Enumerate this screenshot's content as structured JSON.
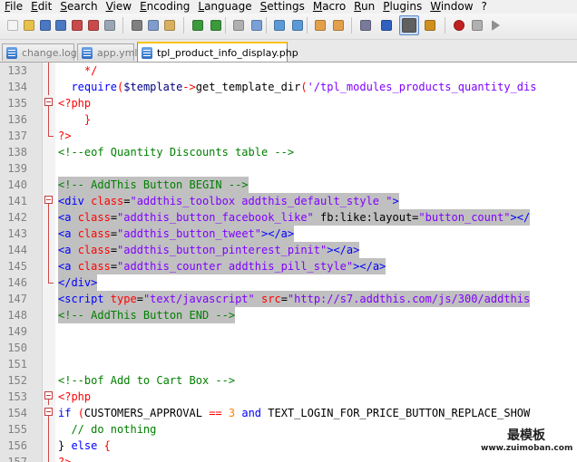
{
  "menu": [
    "File",
    "Edit",
    "Search",
    "View",
    "Encoding",
    "Language",
    "Settings",
    "Macro",
    "Run",
    "Plugins",
    "Window",
    "?"
  ],
  "toolbar": {
    "icons": [
      "new-file-icon",
      "open-file-icon",
      "save-icon",
      "save-all-icon",
      "close-icon",
      "close-all-icon",
      "print-icon",
      "cut-icon",
      "copy-icon",
      "paste-icon",
      "undo-icon",
      "redo-icon",
      "find-icon",
      "replace-icon",
      "zoom-in-icon",
      "zoom-out-icon",
      "sync-vertical-icon",
      "sync-horizontal-icon",
      "word-wrap-icon",
      "show-all-chars-icon",
      "indent-guide-icon",
      "user-lang-icon",
      "record-macro-icon",
      "stop-macro-icon",
      "play-macro-icon"
    ],
    "colors": {
      "bg": "#f0f0f0",
      "selected": "#c9dcf5"
    }
  },
  "tabs": [
    {
      "label": "change.log",
      "active": false
    },
    {
      "label": "app.yml",
      "active": false
    },
    {
      "label": "tpl_product_info_display.php",
      "active": true
    }
  ],
  "editor": {
    "lines": [
      {
        "n": "133",
        "fold": "line",
        "hl": false,
        "tokens": [
          [
            "plain",
            "    "
          ],
          [
            "op",
            "*/"
          ]
        ]
      },
      {
        "n": "134",
        "fold": "line",
        "hl": false,
        "tokens": [
          [
            "plain",
            "  "
          ],
          [
            "kw",
            "require"
          ],
          [
            "op",
            "("
          ],
          [
            "var",
            "$template"
          ],
          [
            "op",
            "->"
          ],
          [
            "plain",
            "get_template_dir"
          ],
          [
            "op",
            "("
          ],
          [
            "str",
            "'/tpl_modules_products_quantity_dis"
          ]
        ]
      },
      {
        "n": "135",
        "fold": "box",
        "hl": false,
        "tokens": [
          [
            "php",
            "<?php"
          ]
        ]
      },
      {
        "n": "136",
        "fold": "line",
        "hl": false,
        "tokens": [
          [
            "plain",
            "    "
          ],
          [
            "op",
            "}"
          ]
        ]
      },
      {
        "n": "137",
        "fold": "end",
        "hl": false,
        "tokens": [
          [
            "php",
            "?>"
          ]
        ]
      },
      {
        "n": "138",
        "fold": "none",
        "hl": false,
        "tokens": [
          [
            "cmt",
            "<!--eof Quantity Discounts table -->"
          ]
        ]
      },
      {
        "n": "139",
        "fold": "none",
        "hl": false,
        "tokens": []
      },
      {
        "n": "140",
        "fold": "none",
        "hl": true,
        "tokens": [
          [
            "cmt",
            "<!-- AddThis Button BEGIN -->"
          ]
        ]
      },
      {
        "n": "141",
        "fold": "box",
        "hl": true,
        "tokens": [
          [
            "tag",
            "<div "
          ],
          [
            "attr",
            "class"
          ],
          [
            "plain",
            "="
          ],
          [
            "str",
            "\"addthis_toolbox addthis_default_style \""
          ],
          [
            "tag",
            ">"
          ]
        ]
      },
      {
        "n": "142",
        "fold": "line",
        "hl": true,
        "tokens": [
          [
            "tag",
            "<a "
          ],
          [
            "attr",
            "class"
          ],
          [
            "plain",
            "="
          ],
          [
            "str",
            "\"addthis_button_facebook_like\""
          ],
          [
            "plain",
            " fb:like:layout="
          ],
          [
            "str",
            "\"button_count\""
          ],
          [
            "tag",
            "></"
          ]
        ]
      },
      {
        "n": "143",
        "fold": "line",
        "hl": true,
        "tokens": [
          [
            "tag",
            "<a "
          ],
          [
            "attr",
            "class"
          ],
          [
            "plain",
            "="
          ],
          [
            "str",
            "\"addthis_button_tweet\""
          ],
          [
            "tag",
            "></a>"
          ]
        ]
      },
      {
        "n": "144",
        "fold": "line",
        "hl": true,
        "tokens": [
          [
            "tag",
            "<a "
          ],
          [
            "attr",
            "class"
          ],
          [
            "plain",
            "="
          ],
          [
            "str",
            "\"addthis_button_pinterest_pinit\""
          ],
          [
            "tag",
            "></a>"
          ]
        ]
      },
      {
        "n": "145",
        "fold": "line",
        "hl": true,
        "tokens": [
          [
            "tag",
            "<a "
          ],
          [
            "attr",
            "class"
          ],
          [
            "plain",
            "="
          ],
          [
            "str",
            "\"addthis_counter addthis_pill_style\""
          ],
          [
            "tag",
            "></a>"
          ]
        ]
      },
      {
        "n": "146",
        "fold": "end",
        "hl": true,
        "tokens": [
          [
            "tag",
            "</div>"
          ]
        ]
      },
      {
        "n": "147",
        "fold": "none",
        "hl": true,
        "tokens": [
          [
            "tag",
            "<script "
          ],
          [
            "attr",
            "type"
          ],
          [
            "plain",
            "="
          ],
          [
            "str",
            "\"text/javascript\""
          ],
          [
            "plain",
            " "
          ],
          [
            "attr",
            "src"
          ],
          [
            "plain",
            "="
          ],
          [
            "str",
            "\"http://s7.addthis.com/js/300/addthis"
          ]
        ]
      },
      {
        "n": "148",
        "fold": "none",
        "hl": true,
        "tokens": [
          [
            "cmt",
            "<!-- AddThis Button END -->"
          ]
        ]
      },
      {
        "n": "149",
        "fold": "none",
        "hl": false,
        "tokens": []
      },
      {
        "n": "150",
        "fold": "none",
        "hl": false,
        "tokens": []
      },
      {
        "n": "151",
        "fold": "none",
        "hl": false,
        "tokens": []
      },
      {
        "n": "152",
        "fold": "none",
        "hl": false,
        "tokens": [
          [
            "cmt",
            "<!--bof Add to Cart Box -->"
          ]
        ]
      },
      {
        "n": "153",
        "fold": "box",
        "hl": false,
        "tokens": [
          [
            "php",
            "<?php"
          ]
        ]
      },
      {
        "n": "154",
        "fold": "box",
        "hl": false,
        "tokens": [
          [
            "kw",
            "if"
          ],
          [
            "plain",
            " "
          ],
          [
            "op",
            "("
          ],
          [
            "plain",
            "CUSTOMERS_APPROVAL "
          ],
          [
            "op",
            "=="
          ],
          [
            "plain",
            " "
          ],
          [
            "num",
            "3"
          ],
          [
            "plain",
            " "
          ],
          [
            "kw",
            "and"
          ],
          [
            "plain",
            " TEXT_LOGIN_FOR_PRICE_BUTTON_REPLACE_SHOW"
          ]
        ]
      },
      {
        "n": "155",
        "fold": "line",
        "hl": false,
        "tokens": [
          [
            "plain",
            "  "
          ],
          [
            "cmt",
            "// do nothing"
          ]
        ]
      },
      {
        "n": "156",
        "fold": "line",
        "hl": false,
        "tokens": [
          [
            "plain",
            "} "
          ],
          [
            "kw",
            "else"
          ],
          [
            "plain",
            " "
          ],
          [
            "op",
            "{"
          ]
        ]
      },
      {
        "n": "157",
        "fold": "line",
        "hl": false,
        "tokens": [
          [
            "php",
            "?>"
          ]
        ]
      }
    ]
  },
  "watermark": {
    "cn": "最模板",
    "url": "www.zuimoban.com"
  }
}
